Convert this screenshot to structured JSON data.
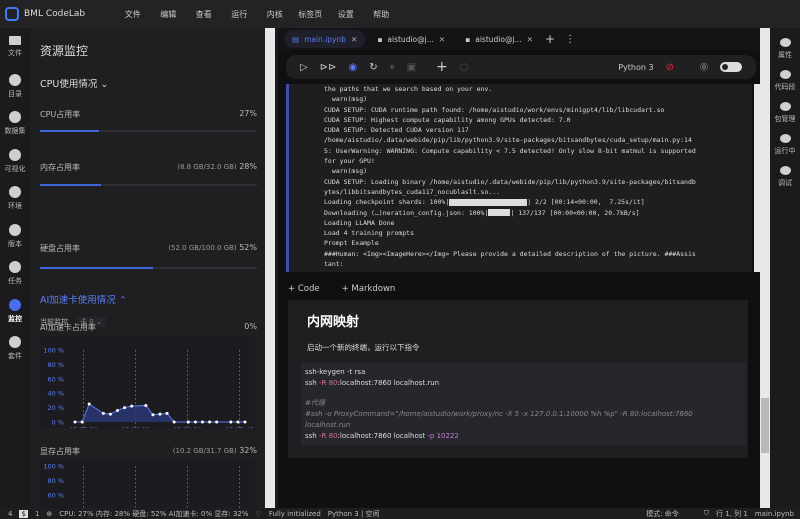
{
  "app": {
    "title": "BML CodeLab",
    "menu": [
      "文件",
      "编辑",
      "查看",
      "运行",
      "内核",
      "标签页",
      "设置",
      "帮助"
    ]
  },
  "left_rail": [
    {
      "label": "文件",
      "icon": "folder-icon"
    },
    {
      "label": "目录",
      "icon": "toc-icon"
    },
    {
      "label": "数据集",
      "icon": "dataset-icon"
    },
    {
      "label": "可视化",
      "icon": "chart-icon"
    },
    {
      "label": "环境",
      "icon": "env-icon"
    },
    {
      "label": "版本",
      "icon": "version-icon"
    },
    {
      "label": "任务",
      "icon": "task-icon"
    },
    {
      "label": "监控",
      "icon": "monitor-icon",
      "active": true
    },
    {
      "label": "套件",
      "icon": "suite-icon"
    }
  ],
  "monitor": {
    "title": "资源监控",
    "cpu_section": "CPU使用情况",
    "cpu": {
      "label": "CPU占用率",
      "detail": "",
      "value": "27%",
      "fraction": 0.27
    },
    "mem": {
      "label": "内存占用率",
      "detail": "(8.8 GB/32.0 GB)",
      "value": "28%",
      "fraction": 0.28
    },
    "disk": {
      "label": "硬盘占用率",
      "detail": "(52.0 GB/100.0 GB)",
      "value": "52%",
      "fraction": 0.52
    },
    "ai_section": "AI加速卡使用情况",
    "current_label": "当前监控",
    "card_select": "卡 0",
    "ai_usage": {
      "label": "AI加速卡占用率",
      "value": "0%"
    },
    "vram": {
      "label": "显存占用率",
      "detail": "(10.2 GB/31.7 GB)",
      "value": "32%"
    }
  },
  "chart_data": [
    {
      "type": "area",
      "title": "AI加速卡占用率",
      "ylim": [
        0,
        100
      ],
      "yticks": [
        "100 %",
        "80 %",
        "60 %",
        "40 %",
        "20 %",
        "0 %"
      ],
      "xticks": [
        "07:55:38",
        "07:56:22",
        "07:56:59",
        "07:57:45"
      ],
      "grid": "vertical dashed",
      "x": [
        0,
        1,
        2,
        4,
        5,
        6,
        7,
        8,
        10,
        11,
        12,
        13,
        14,
        16,
        17,
        18,
        19,
        20,
        22,
        23,
        24
      ],
      "values": [
        0,
        0,
        25,
        12,
        11,
        16,
        20,
        22,
        23,
        10,
        11,
        12,
        0,
        0,
        0,
        0,
        0,
        0,
        0,
        0,
        0
      ],
      "color": "#4a6cf0"
    },
    {
      "type": "area",
      "title": "显存占用率",
      "ylim": [
        0,
        100
      ],
      "yticks": [
        "100 %",
        "80 %",
        "60 %"
      ],
      "xticks": [],
      "values": []
    }
  ],
  "tabs": [
    {
      "label": "main.ipynb",
      "active": true
    },
    {
      "label": "aistudio@j..."
    },
    {
      "label": "aistudio@j..."
    }
  ],
  "toolbar": {
    "kernel": "Python 3"
  },
  "output_lines": [
    "the paths that we search based on your env.",
    "  warn(msg)",
    "CUDA SETUP: CUDA runtime path found: /home/aistudio/work/envs/minigpt4/lib/libcudart.so",
    "CUDA SETUP: Highest compute capability among GPUs detected: 7.0",
    "CUDA SETUP: Detected CUDA version 117",
    "/home/aistudio/.data/webide/pip/lib/python3.9/site-packages/bitsandbytes/cuda_setup/main.py:14",
    "5: UserWarning: WARNING: Compute capability < 7.5 detected! Only slow 8-bit matmul is supported",
    "for your GPU!",
    "  warn(msg)",
    "CUDA SETUP: Loading binary /home/aistudio/.data/webide/pip/lib/python3.9/site-packages/bitsandb",
    "ytes/libbitsandbytes_cuda117_nocublaslt.so..."
  ],
  "progress": [
    {
      "prefix": "Loading checkpoint shards: 100%|",
      "suffix": "| 2/2 [00:14<00:00,  7.25s/it]",
      "fraction": 1.0
    },
    {
      "prefix": "Downloading (…)neration_config.json: 100%|",
      "suffix": "| 137/137 [00:00<00:00, 20.7kB/s]",
      "fraction": 1.0
    }
  ],
  "output_tail": [
    "Loading LLAMA Done",
    "Load 4 training prompts",
    "Prompt Example",
    "###Human: <Img><ImageHere></Img> Please provide a detailed description of the picture. ###Assis",
    "tant:"
  ],
  "add": {
    "code": "Code",
    "markdown": "Markdown"
  },
  "markdown": {
    "heading": "内网映射",
    "text": "启动一个新的终端，运行以下指令",
    "code": {
      "l1": "ssh-keygen -t rsa",
      "l2a": "ssh",
      "l2b": "-R",
      "l2c": "80",
      "l2d": ":localhost:7860 localhost.run",
      "c1": "#代理",
      "c2": "#ssh -o ProxyCommand=\"/home/aistudio/work/proxy/nc -X 5 -x 127.0.0.1:10000 %h %p\" -R 80:localhost:7860",
      "c3": "localhost.run",
      "l4a": "ssh",
      "l4b": "-R",
      "l4c": "80",
      "l4d": ":localhost:7860 localhost",
      "l4e": "-p",
      "l4f": "10222"
    }
  },
  "right_rail": [
    {
      "label": "属性",
      "icon": "gears-icon"
    },
    {
      "label": "代码段",
      "icon": "snippet-icon"
    },
    {
      "label": "包管理",
      "icon": "package-icon"
    },
    {
      "label": "运行中",
      "icon": "running-icon"
    },
    {
      "label": "调试",
      "icon": "debug-icon"
    }
  ],
  "status": {
    "n1": "4",
    "n2": "1",
    "metrics": "CPU:  27% 内存:  28% 硬盘:  52% AI加速卡:  0% 显存:  32%",
    "init": "Fully initialized",
    "kernel": "Python 3 | 空闲",
    "mode": "模式:  命令",
    "pos": "行 1, 列 1",
    "file": "main.ipynb"
  }
}
